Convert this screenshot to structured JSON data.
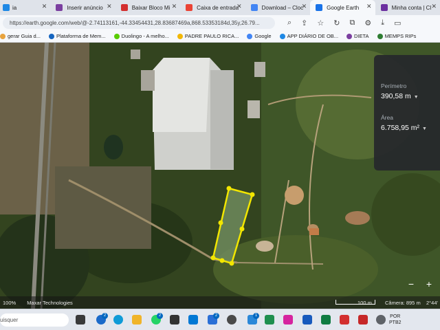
{
  "tabs": [
    {
      "label": "ia",
      "fav_color": "#1e88e5"
    },
    {
      "label": "Inserir anúncio",
      "fav_color": "#7b3fa0"
    },
    {
      "label": "Baixar Bloco Mi",
      "fav_color": "#d32f2f"
    },
    {
      "label": "Caixa de entrada",
      "fav_color": "#ea4335"
    },
    {
      "label": "Download – Cloc",
      "fav_color": "#4285f4"
    },
    {
      "label": "Google Earth",
      "fav_color": "#1a73e8"
    },
    {
      "label": "Minha conta | Cl",
      "fav_color": "#6b2fa0"
    }
  ],
  "address": {
    "url": "https://earth.google.com/web/@-2.74113161,-44.33454431,28.83687469a,868.53353184d,35y,26.79..."
  },
  "bookmarks": [
    {
      "label": "gerar Guia d...",
      "color": "#e8a33d"
    },
    {
      "label": "Plataforma de Mem...",
      "color": "#1565c0"
    },
    {
      "label": "Duolingo - A melho...",
      "color": "#58cc02"
    },
    {
      "label": "PADRE PAULO RICA...",
      "color": "#f2b705"
    },
    {
      "label": "Google",
      "color": "#4285f4"
    },
    {
      "label": "APP DIÁRIO DE OB...",
      "color": "#1e88e5"
    },
    {
      "label": "DIETA",
      "color": "#7b3fa0"
    },
    {
      "label": "MEMPS RIPs",
      "color": "#2e7d32"
    }
  ],
  "measure": {
    "perimeter_label": "Perímetro",
    "perimeter_value": "390,58 m",
    "area_label": "Área",
    "area_value": "6.758,95 m²"
  },
  "zoom": {
    "minus": "−",
    "plus": "+"
  },
  "footer": {
    "zoom_pct": "100%",
    "attribution": "Maxar Technologies",
    "scale_label": "100 m",
    "camera": "Câmera: 895 m",
    "coords": "2°44'"
  },
  "taskbar": {
    "search_placeholder": "uisquer",
    "badges": [
      "2",
      "2",
      "2",
      "1"
    ],
    "tray_line1": "POR",
    "tray_line2": "PTB2"
  },
  "colors": {
    "accent": "#1a73e8",
    "polygon": "#f2e600"
  }
}
